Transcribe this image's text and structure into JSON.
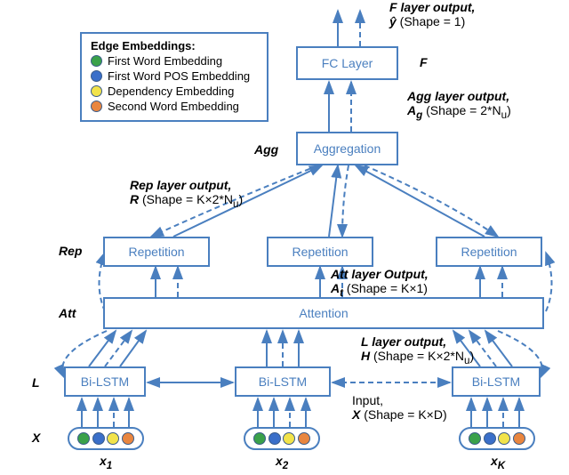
{
  "legend": {
    "title": "Edge Embeddings:",
    "items": [
      {
        "label": "First Word Embedding"
      },
      {
        "label": "First Word POS Embedding"
      },
      {
        "label": "Dependency Embedding"
      },
      {
        "label": "Second Word Embedding"
      }
    ]
  },
  "blocks": {
    "fc": "FC Layer",
    "agg": "Aggregation",
    "rep": "Repetition",
    "att": "Attention",
    "bilstm": "Bi-LSTM"
  },
  "layer_labels": {
    "F": "F",
    "Agg": "Agg",
    "Rep": "Rep",
    "Att": "Att",
    "L": "L",
    "X": "X"
  },
  "annotations": {
    "f_out": "F layer output,",
    "f_out2_pre": "ŷ",
    "f_out2": " (Shape = 1)",
    "agg_out": "Agg layer output,",
    "agg_out2_pre": "A",
    "agg_out2_sub": "g",
    "agg_out2": " (Shape = 2*N",
    "agg_out2_subu": "u",
    "agg_out2_end": ")",
    "rep_out": "Rep layer output,",
    "rep_out2_pre": "R",
    "rep_out2": " (Shape = K×2*N",
    "rep_out2_subu": "u",
    "rep_out2_end": ")",
    "att_out": "Att layer Output,",
    "att_out2_pre": "A",
    "att_out2_sub": "t",
    "att_out2": " (Shape = K×1)",
    "l_out": "L layer output,",
    "l_out2_pre": "H",
    "l_out2": " (Shape = K×2*N",
    "l_out2_subu": "u",
    "l_out2_end": ")",
    "input": "Input,",
    "input2_pre": "X",
    "input2": " (Shape = K×D)"
  },
  "x_labels": {
    "x1": "x",
    "x1_sub": "1",
    "x2": "x",
    "x2_sub": "2",
    "xk": "x",
    "xk_sub": "K"
  }
}
